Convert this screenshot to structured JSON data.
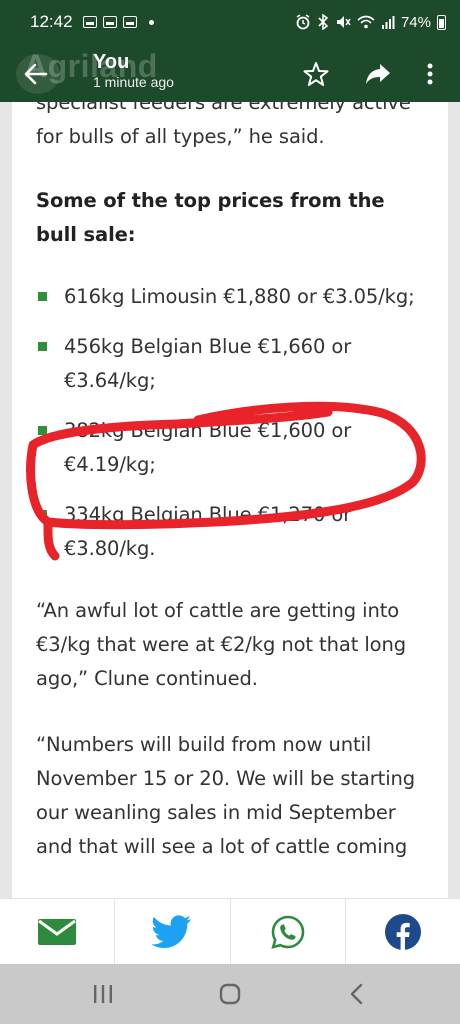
{
  "status_bar": {
    "time": "12:42",
    "battery_text": "74%",
    "left_icons": [
      "gallery-icon",
      "notification-icon",
      "notification-icon",
      "dot-icon"
    ],
    "right_icons": [
      "alarm-icon",
      "bluetooth-icon",
      "mute-icon",
      "wifi-icon",
      "signal-icon",
      "battery-icon"
    ]
  },
  "app_bar": {
    "logo_text": "Agriland",
    "title": "You",
    "subtitle": "1 minute ago",
    "actions": [
      "star-icon",
      "share-icon",
      "more-vert-icon"
    ]
  },
  "article": {
    "partial_top_line": "specialist feeders are extremely active",
    "intro_tail": "for bulls of all types,” he said.",
    "heading": "Some of the top prices from the bull sale:",
    "prices": [
      "616kg Limousin €1,880 or €3.05/kg;",
      "456kg Belgian Blue €1,660 or €3.64/kg;",
      "382kg Belgian Blue €1,600 or €4.19/kg;",
      "334kg Belgian Blue €1,270 or €3.80/kg."
    ],
    "quote1": "“An awful lot of cattle are getting into €3/kg that were at €2/kg not that long ago,” Clune continued.",
    "quote2": "“Numbers will build from now until November 15 or 20. We will be starting our weanling sales in mid September and that will see a lot of cattle coming"
  },
  "annotation": {
    "color": "#e8232a",
    "highlighted_item": 2
  },
  "share_bar": {
    "buttons": [
      "email-icon",
      "twitter-icon",
      "whatsapp-icon",
      "facebook-icon"
    ],
    "colors": {
      "email": "#2e8b3e",
      "twitter": "#1da1f2",
      "whatsapp": "#2e8b3e",
      "facebook": "#1d4a8a"
    }
  },
  "nav_bar": {
    "buttons": [
      "recent-apps-icon",
      "home-icon",
      "back-icon"
    ]
  },
  "colors": {
    "brand_green": "#1d4a2a",
    "bullet_green": "#2f8f3f"
  }
}
